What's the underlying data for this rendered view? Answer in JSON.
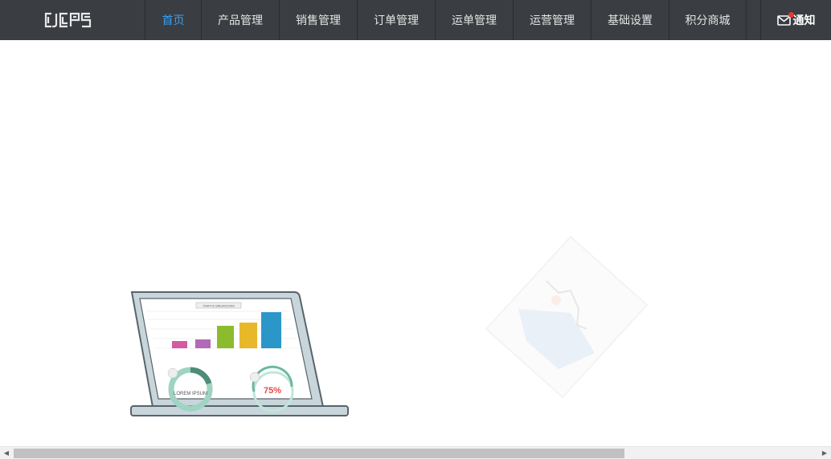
{
  "header": {
    "logo_text": "CJCPS",
    "nav": [
      {
        "label": "首页",
        "active": true
      },
      {
        "label": "产品管理",
        "active": false
      },
      {
        "label": "销售管理",
        "active": false
      },
      {
        "label": "订单管理",
        "active": false
      },
      {
        "label": "运单管理",
        "active": false
      },
      {
        "label": "运营管理",
        "active": false
      },
      {
        "label": "基础设置",
        "active": false
      },
      {
        "label": "积分商城",
        "active": false
      }
    ],
    "notify_label": "通知"
  },
  "illustration": {
    "screen_title": "TRAFFIC BREAKDOWN",
    "left_ring_label": "LOREM IPSUM",
    "right_ring_value": "75%"
  },
  "colors": {
    "header_bg": "#3a3d41",
    "active_nav": "#3aa0f2",
    "notify_dot": "#e8392f"
  }
}
